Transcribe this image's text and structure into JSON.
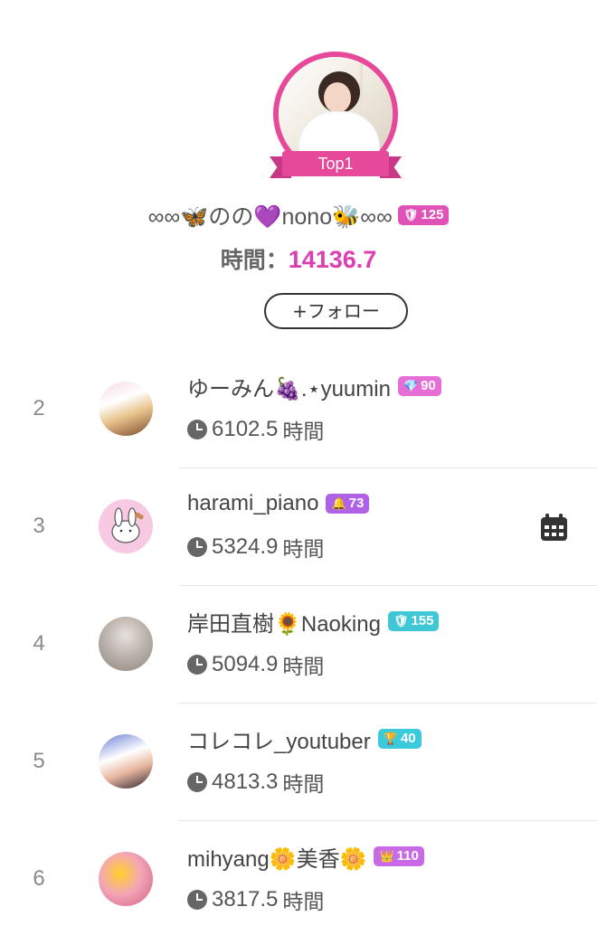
{
  "top1": {
    "ribbon_label": "Top1",
    "name": "∞∞🦋のの💜nono🐝∞∞",
    "badge": {
      "icon": "shield-heart-icon",
      "value": "125",
      "color": "#e052b8"
    },
    "time_label": "時間：",
    "time_value": "14136.7",
    "follow_label": "+フォロー"
  },
  "ranks": [
    {
      "rank": "2",
      "name": "ゆーみん🍇.⋆yuumin",
      "badge_icon": "diamond-icon",
      "badge_value": "90",
      "badge_color": "#e56fd6",
      "time": "6102.5",
      "unit": "時間",
      "avatar": "av2"
    },
    {
      "rank": "3",
      "name": "harami_piano",
      "badge_icon": "bell-icon",
      "badge_value": "73",
      "badge_color": "#b062e6",
      "time": "5324.9",
      "unit": "時間",
      "avatar": "av3"
    },
    {
      "rank": "4",
      "name": "岸田直樹🌻Naoking",
      "badge_icon": "shield-heart-icon",
      "badge_value": "155",
      "badge_color": "#3fc7d6",
      "time": "5094.9",
      "unit": "時間",
      "avatar": "av4"
    },
    {
      "rank": "5",
      "name": "コレコレ_youtuber",
      "badge_icon": "trophy-icon",
      "badge_value": "40",
      "badge_color": "#3bc9dc",
      "time": "4813.3",
      "unit": "時間",
      "avatar": "av5"
    },
    {
      "rank": "6",
      "name": "mihyang🌼美香🌼",
      "badge_icon": "crown-icon",
      "badge_value": "110",
      "badge_color": "#c86ae6",
      "time": "3817.5",
      "unit": "時間",
      "avatar": "av6"
    }
  ],
  "calendar_icon": "calendar-icon"
}
